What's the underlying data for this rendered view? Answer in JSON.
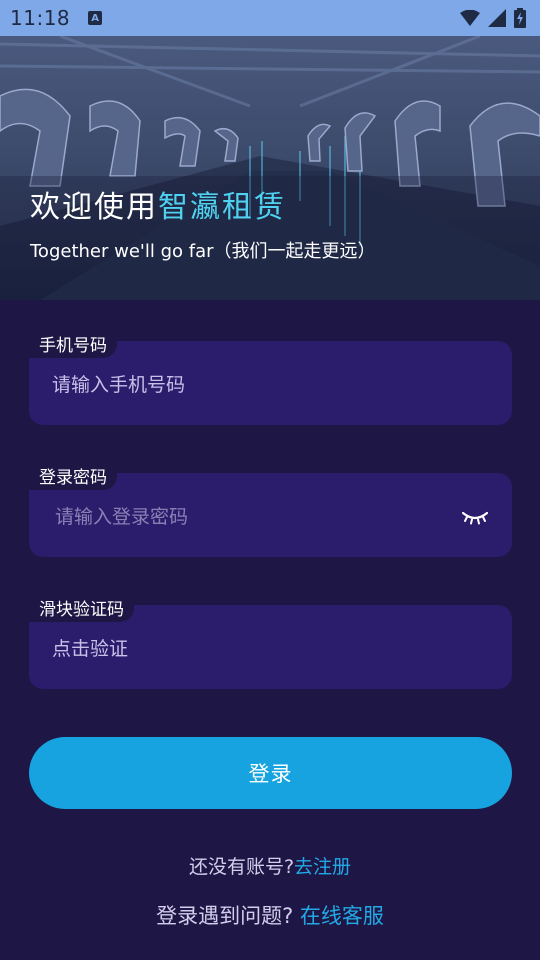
{
  "status_bar": {
    "time": "11:18",
    "notification_icon_label": "A",
    "icons": [
      "wifi-icon",
      "cellular-signal-icon",
      "battery-charging-icon"
    ]
  },
  "hero": {
    "title_prefix": "欢迎使用",
    "title_brand": "智瀛租赁",
    "subtitle": "Together we'll go far（我们一起走更远）",
    "brand_color": "#4fd2f0"
  },
  "form": {
    "phone": {
      "label": "手机号码",
      "placeholder": "请输入手机号码"
    },
    "password": {
      "label": "登录密码",
      "placeholder": "请输入登录密码",
      "toggle_icon": "eye-closed-icon"
    },
    "captcha": {
      "label": "滑块验证码",
      "placeholder": "点击验证"
    },
    "submit_label": "登录"
  },
  "footer": {
    "register_prompt": "还没有账号?",
    "register_link": "去注册",
    "help_prompt": "登录遇到问题?",
    "help_link": "在线客服"
  },
  "colors": {
    "background": "#1e1644",
    "field_background": "#2b1d6b",
    "button": "#17a3e0",
    "link": "#22a8e6",
    "status_bar": "#7fa8e8"
  }
}
